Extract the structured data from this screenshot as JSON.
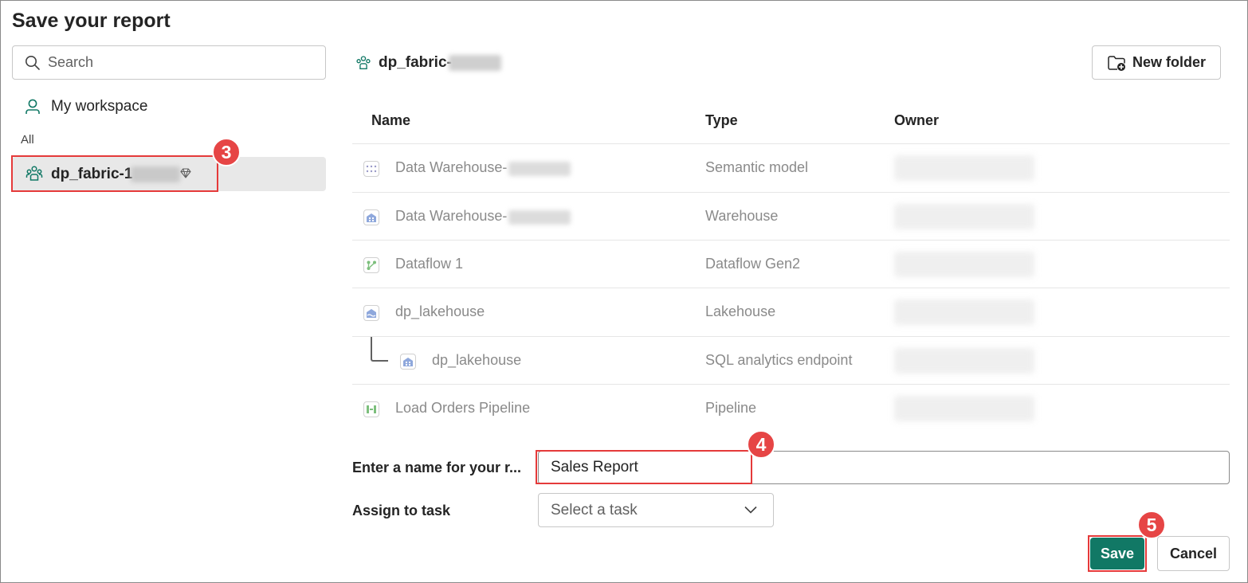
{
  "dialog": {
    "title": "Save your report"
  },
  "sidebar": {
    "search_placeholder": "Search",
    "my_workspace_label": "My workspace",
    "section_label": "All",
    "workspace_name": "dp_fabric-1",
    "workspace_badge_icon": "premium-diamond-icon"
  },
  "main": {
    "breadcrumb_label": "dp_fabric-",
    "new_folder_label": "New folder",
    "columns": [
      "Name",
      "Type",
      "Owner"
    ],
    "rows": [
      {
        "name": "Data Warehouse-",
        "type": "Semantic model",
        "icon": "semantic-model-icon"
      },
      {
        "name": "Data Warehouse-",
        "type": "Warehouse",
        "icon": "warehouse-icon"
      },
      {
        "name": "Dataflow 1",
        "type": "Dataflow Gen2",
        "icon": "dataflow-icon"
      },
      {
        "name": "dp_lakehouse",
        "type": "Lakehouse",
        "icon": "lakehouse-icon"
      },
      {
        "name": "dp_lakehouse",
        "type": "SQL analytics endpoint",
        "icon": "sql-endpoint-icon"
      },
      {
        "name": "Load Orders Pipeline",
        "type": "Pipeline",
        "icon": "pipeline-icon"
      }
    ]
  },
  "form": {
    "name_label": "Enter a name for your r...",
    "name_value": "Sales Report",
    "task_label": "Assign to task",
    "task_placeholder": "Select a task"
  },
  "buttons": {
    "save": "Save",
    "cancel": "Cancel"
  },
  "steps": {
    "step_3": "3",
    "step_4": "4",
    "step_5": "5"
  },
  "colors": {
    "accent": "#117865",
    "highlight": "#e53a3a",
    "step_badge": "#e64545"
  }
}
